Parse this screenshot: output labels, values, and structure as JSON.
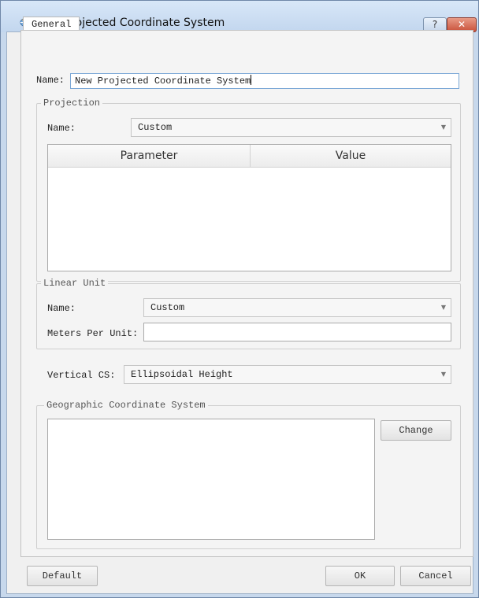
{
  "window": {
    "title": "New Projected Coordinate System",
    "help_label": "?",
    "close_label": "✕"
  },
  "tabs": [
    {
      "label": "General",
      "active": true
    }
  ],
  "name_field": {
    "label": "Name:",
    "value": "New Projected Coordinate System"
  },
  "projection": {
    "group_title": "Projection",
    "name_label": "Name:",
    "name_value": "Custom",
    "table": {
      "columns": [
        "Parameter",
        "Value"
      ],
      "rows": []
    }
  },
  "linear_unit": {
    "group_title": "Linear Unit",
    "name_label": "Name:",
    "name_value": "Custom",
    "meters_label": "Meters Per Unit:",
    "meters_value": ""
  },
  "vertical_cs": {
    "label": "Vertical CS:",
    "value": "Ellipsoidal Height"
  },
  "geographic_cs": {
    "group_title": "Geographic Coordinate System",
    "text": "",
    "change_label": "Change"
  },
  "footer": {
    "default_label": "Default",
    "ok_label": "OK",
    "cancel_label": "Cancel"
  },
  "icons": {
    "app": "globe-app-icon",
    "dropdown": "chevron-down-icon"
  },
  "colors": {
    "titlebar": "#c7d8ec",
    "close_button": "#c9523b"
  }
}
